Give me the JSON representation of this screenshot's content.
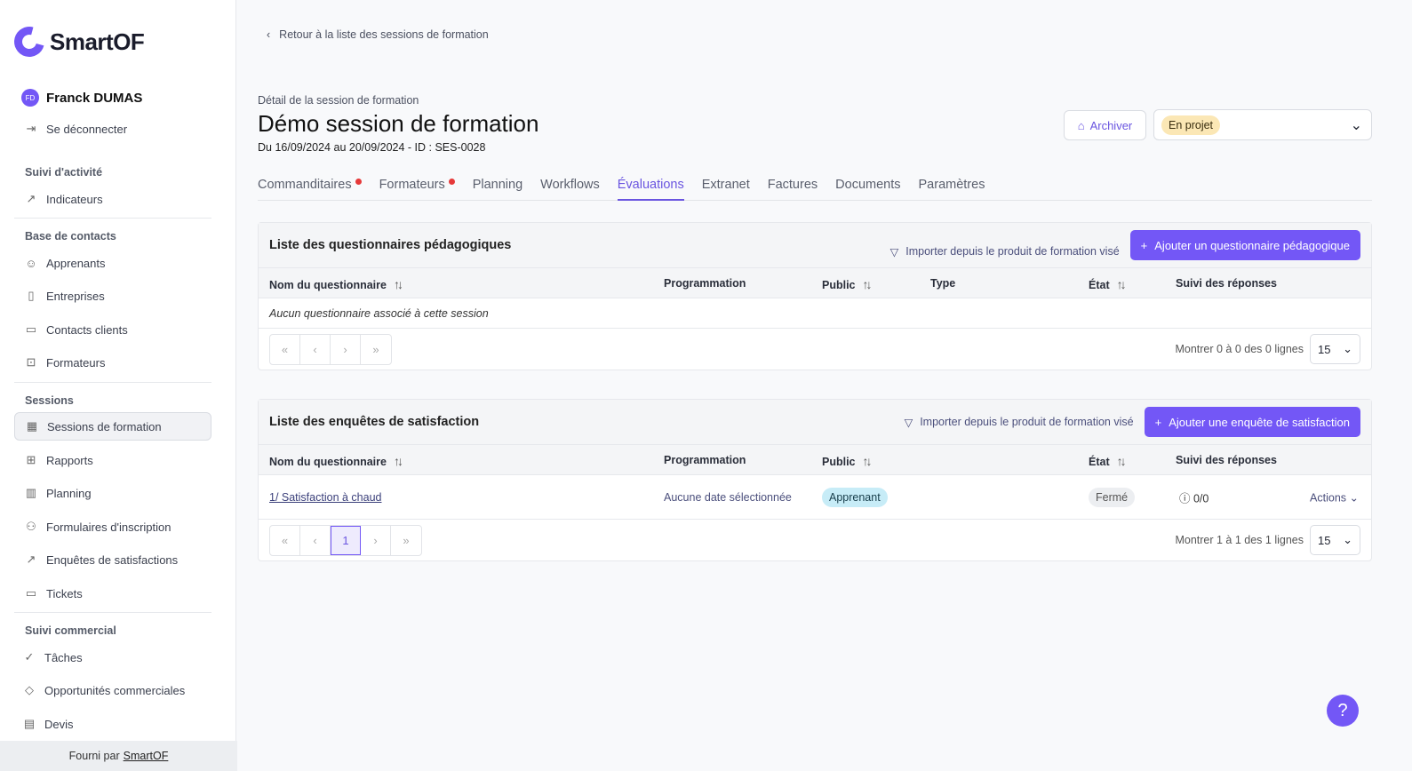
{
  "brand": {
    "name": "SmartOF",
    "accent": "#7357f6"
  },
  "user": {
    "initials": "FD",
    "name": "Franck DUMAS",
    "logout": "Se déconnecter"
  },
  "sidebar": {
    "sections": [
      "Suivi d'activité",
      "Base de contacts",
      "Sessions",
      "Suivi commercial"
    ],
    "items": [
      {
        "label": "Indicateurs",
        "icon": "chart-line-icon"
      },
      {
        "label": "Apprenants",
        "icon": "users-icon"
      },
      {
        "label": "Entreprises",
        "icon": "building-icon"
      },
      {
        "label": "Contacts clients",
        "icon": "contact-card-icon"
      },
      {
        "label": "Formateurs",
        "icon": "briefcase-icon"
      },
      {
        "label": "Sessions de formation",
        "icon": "calendar-icon"
      },
      {
        "label": "Rapports",
        "icon": "table-icon"
      },
      {
        "label": "Planning",
        "icon": "map-icon"
      },
      {
        "label": "Formulaires d'inscription",
        "icon": "user-add-icon"
      },
      {
        "label": "Enquêtes de satisfactions",
        "icon": "chart-line-icon"
      },
      {
        "label": "Tickets",
        "icon": "ticket-icon"
      },
      {
        "label": "Tâches",
        "icon": "check-circle-icon"
      },
      {
        "label": "Opportunités commerciales",
        "icon": "tag-icon"
      },
      {
        "label": "Devis",
        "icon": "document-icon"
      }
    ],
    "footer_prefix": "Fourni par",
    "footer_link": "SmartOF"
  },
  "header": {
    "back": "Retour à la liste des sessions de formation",
    "subtitle": "Détail de la session de formation",
    "title": "Démo session de formation",
    "dates": "Du 16/09/2024 au 20/09/2024 - ID : SES-0028",
    "archive": "Archiver",
    "status": "En projet"
  },
  "tabs": [
    {
      "label": "Commanditaires",
      "dot": true
    },
    {
      "label": "Formateurs",
      "dot": true
    },
    {
      "label": "Planning"
    },
    {
      "label": "Workflows"
    },
    {
      "label": "Évaluations",
      "active": true
    },
    {
      "label": "Extranet"
    },
    {
      "label": "Factures"
    },
    {
      "label": "Documents"
    },
    {
      "label": "Paramètres"
    }
  ],
  "pedago": {
    "title": "Liste des questionnaires pédagogiques",
    "import": "Importer depuis le produit de formation visé",
    "add": "Ajouter un questionnaire pédagogique",
    "columns": [
      "Nom du questionnaire",
      "Programmation",
      "Public",
      "Type",
      "État",
      "Suivi des réponses"
    ],
    "empty": "Aucun questionnaire associé à cette session",
    "count": "Montrer 0 à 0 des 0 lignes",
    "page_size": "15"
  },
  "satisf": {
    "title": "Liste des enquêtes de satisfaction",
    "import": "Importer depuis le produit de formation visé",
    "add": "Ajouter une enquête de satisfaction",
    "columns": [
      "Nom du questionnaire",
      "Programmation",
      "Public",
      "État",
      "Suivi des réponses"
    ],
    "rows": [
      {
        "name": "1/ Satisfaction à chaud",
        "programmation": "Aucune date sélectionnée",
        "public": "Apprenant",
        "etat": "Fermé",
        "responses": "0/0",
        "actions": "Actions"
      }
    ],
    "page": "1",
    "count": "Montrer 1 à 1 des 1 lignes",
    "page_size": "15"
  },
  "help": "?"
}
